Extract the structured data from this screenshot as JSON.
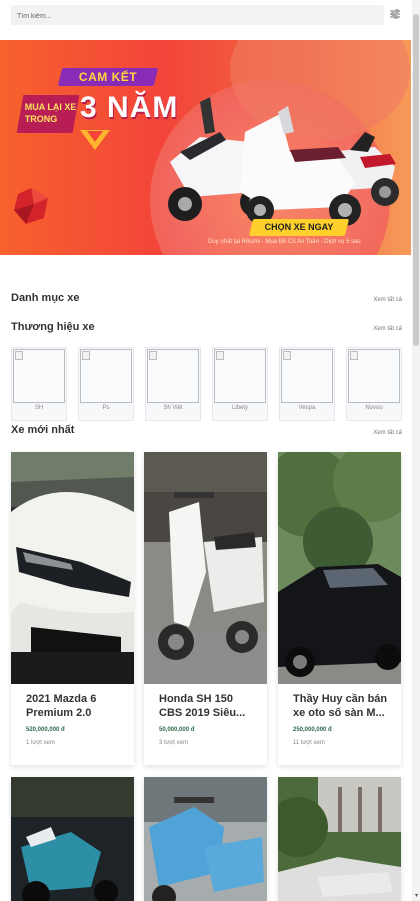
{
  "search": {
    "placeholder": "Tìm kiếm..."
  },
  "icons": {
    "filter": "sliders-icon",
    "scroll_down": "chevron-down-icon"
  },
  "banner": {
    "tag": "CAM KẾT",
    "left_text": "MUA LẠI XE TRONG",
    "big_text": "3 NĂM",
    "cta": "CHỌN XE NGAY",
    "tagline": "Duy nhất tại Rikumi - Mua Đồ Cũ An Toàn - Dịch vụ 5 sao"
  },
  "sections": {
    "categories": {
      "title": "Danh mục xe",
      "see_all": "Xem tất cả"
    },
    "brands": {
      "title": "Thương hiệu xe",
      "see_all": "Xem tất cả"
    },
    "newest": {
      "title": "Xe mới nhất",
      "see_all": "Xem tất cả"
    }
  },
  "brands": [
    {
      "name": "SH"
    },
    {
      "name": "Ps"
    },
    {
      "name": "Sh Việt"
    },
    {
      "name": "Libety"
    },
    {
      "name": "Vespa"
    },
    {
      "name": "Novou"
    }
  ],
  "listings": [
    {
      "title": "2021 Mazda 6 Premium 2.0",
      "price": "520,000,000 đ",
      "views": "1 lượt xem"
    },
    {
      "title": "Honda SH 150 CBS 2019 Siêu...",
      "price": "50,000,000 đ",
      "views": "3 lượt xem"
    },
    {
      "title": "Thầy Huy cần bán xe oto số sàn M...",
      "price": "250,000,000 đ",
      "views": "11 lượt xem"
    }
  ],
  "colors": {
    "price": "#2e6b4a",
    "banner_accent": "#f2443a",
    "cta": "#ffd02c"
  }
}
